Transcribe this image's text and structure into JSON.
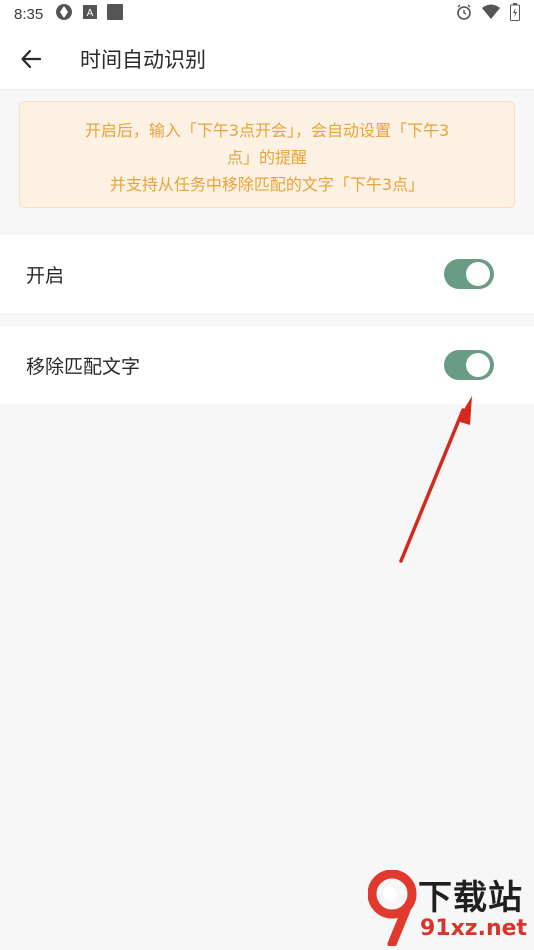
{
  "status_bar": {
    "time": "8:35",
    "icons": [
      "sync-icon",
      "a-box-icon",
      "square-icon",
      "alarm-icon",
      "wifi-icon",
      "battery-icon"
    ]
  },
  "header": {
    "title": "时间自动识别",
    "back_icon": "back-arrow-icon"
  },
  "notice": {
    "line1": "开启后，输入「下午3点开会」，会自动设置「下午3",
    "line2": "点」的提醒",
    "line3": "并支持从任务中移除匹配的文字「下午3点」"
  },
  "settings": [
    {
      "label": "开启",
      "enabled": true
    },
    {
      "label": "移除匹配文字",
      "enabled": true
    }
  ],
  "watermark": {
    "text_cn": "下载站",
    "text_en": "91xz.net"
  },
  "colors": {
    "toggle_on": "#6a9c85",
    "notice_text": "#e7a43a",
    "notice_bg": "#fdf1e3",
    "arrow": "#d42a1e"
  }
}
